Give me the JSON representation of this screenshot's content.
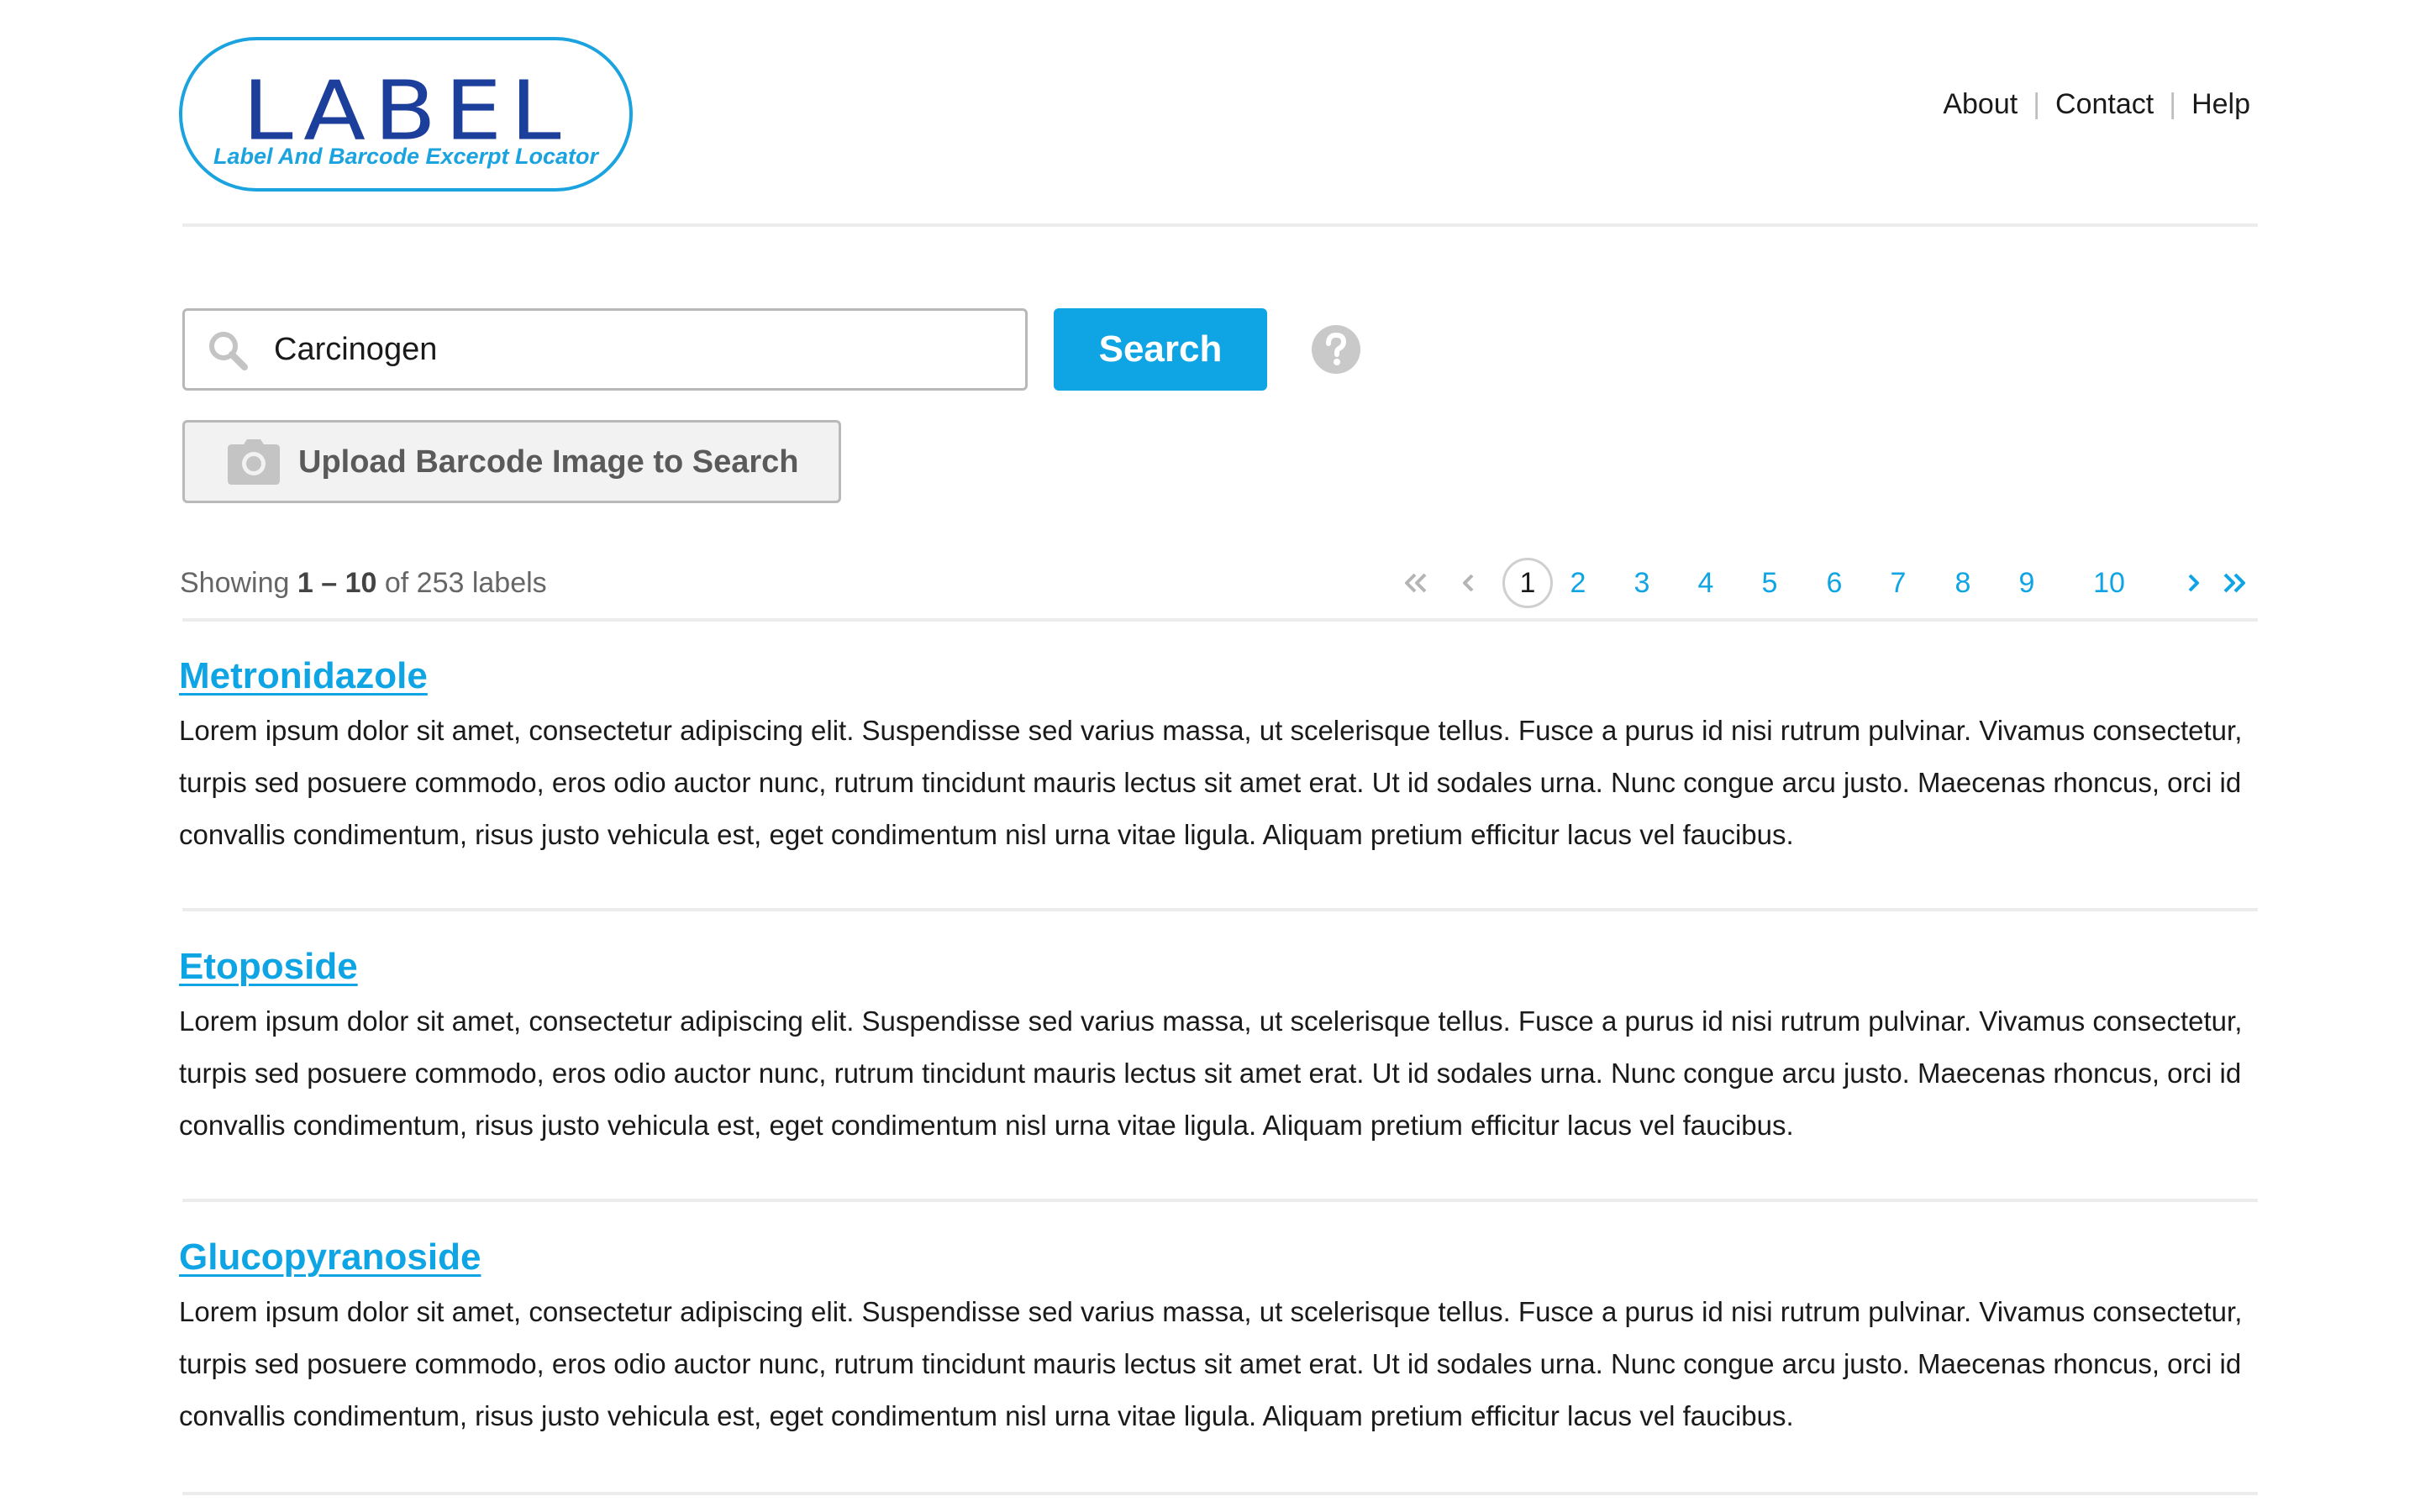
{
  "header": {
    "logo_word": "LABEL",
    "logo_tagline": "Label And Barcode Excerpt Locator",
    "nav": [
      "About",
      "Contact",
      "Help"
    ],
    "nav_separator": "|"
  },
  "search": {
    "value": "Carcinogen",
    "button_label": "Search",
    "upload_label": "Upload Barcode Image to Search"
  },
  "results_bar": {
    "showing_prefix": "Showing",
    "showing_range": "1 – 10",
    "showing_suffix": "of 253 labels"
  },
  "pagination": {
    "current": "1",
    "pages": [
      "2",
      "3",
      "4",
      "5",
      "6",
      "7",
      "8",
      "9",
      "10"
    ]
  },
  "results": [
    {
      "title": "Metronidazole",
      "description": "Lorem ipsum dolor sit amet, consectetur adipiscing elit. Suspendisse sed varius massa, ut scelerisque tellus. Fusce a purus id nisi rutrum pulvinar. Vivamus consectetur, turpis sed posuere commodo, eros odio auctor nunc, rutrum tincidunt mauris lectus sit amet erat. Ut id sodales urna. Nunc congue arcu justo. Maecenas rhoncus, orci id convallis condimentum, risus justo vehicula est, eget condimentum nisl urna vitae ligula. Aliquam pretium efficitur lacus vel faucibus."
    },
    {
      "title": "Etoposide",
      "description": "Lorem ipsum dolor sit amet, consectetur adipiscing elit. Suspendisse sed varius massa, ut scelerisque tellus. Fusce a purus id nisi rutrum pulvinar. Vivamus consectetur, turpis sed posuere commodo, eros odio auctor nunc, rutrum tincidunt mauris lectus sit amet erat. Ut id sodales urna. Nunc congue arcu justo. Maecenas rhoncus, orci id convallis condimentum, risus justo vehicula est, eget condimentum nisl urna vitae ligula. Aliquam pretium efficitur lacus vel faucibus."
    },
    {
      "title": "Glucopyranoside",
      "description": "Lorem ipsum dolor sit amet, consectetur adipiscing elit. Suspendisse sed varius massa, ut scelerisque tellus. Fusce a purus id nisi rutrum pulvinar. Vivamus consectetur, turpis sed posuere commodo, eros odio auctor nunc, rutrum tincidunt mauris lectus sit amet erat. Ut id sodales urna. Nunc congue arcu justo. Maecenas rhoncus, orci id convallis condimentum, risus justo vehicula est, eget condimentum nisl urna vitae ligula. Aliquam pretium efficitur lacus vel faucibus."
    }
  ],
  "icons": {
    "search": "search-icon",
    "help": "help-icon",
    "camera": "camera-icon",
    "first": "double-chevron-left-icon",
    "prev": "chevron-left-icon",
    "next": "chevron-right-icon",
    "last": "double-chevron-right-icon"
  },
  "colors": {
    "accent": "#0fa4e3",
    "logo_dark": "#1d3f9c",
    "text": "#1a1a1a",
    "muted": "#666666",
    "divider": "#ececec",
    "disabled_arrow": "#b5b5b5"
  }
}
